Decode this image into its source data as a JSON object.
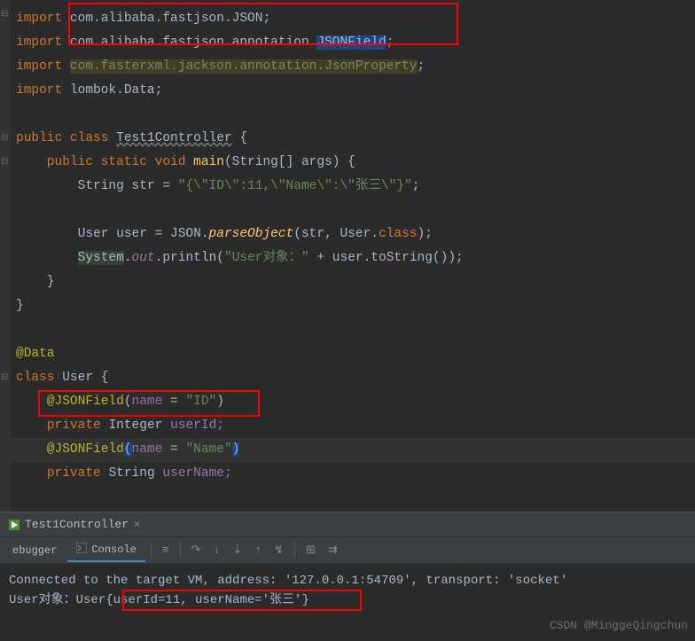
{
  "code": {
    "l1": {
      "kw": "import ",
      "rest": "com.alibaba.fastjson.JSON;"
    },
    "l2": {
      "kw": "import ",
      "rest": "com.alibaba.fastjson.annotation.",
      "hl": "JSONField",
      "end": ";"
    },
    "l3": {
      "kw": "import ",
      "unused": "com.fasterxml.jackson.annotation.JsonProperty",
      "end": ";"
    },
    "l4": {
      "kw": "import ",
      "rest": "lombok.Data;"
    },
    "l6": {
      "pre": "public class ",
      "name": "Test1Controller",
      "post": " {"
    },
    "l7": {
      "pre": "    public static void ",
      "m": "main",
      "post1": "(String[] args) {"
    },
    "l8": {
      "pre": "        String str = ",
      "str": "\"{\\\"ID\\\":11,\\\"Name\\\":\\\"张三\\\"}\"",
      "end": ";"
    },
    "l10": {
      "pre": "        User user = JSON.",
      "m": "parseObject",
      "post": "(str, User.",
      "kw2": "class",
      "end": ");"
    },
    "l11": {
      "pre1": "        ",
      "sys": "System",
      "dot1": ".",
      "out": "out",
      "dot2": ".println(",
      "str": "\"User对象：\"",
      "post": " + user.toString());"
    },
    "l12": "    }",
    "l13": "}",
    "l15": {
      "anno": "@Data"
    },
    "l16": {
      "kw": "class ",
      "name": "User {"
    },
    "l17": {
      "pre": "    ",
      "anno": "@JSONField",
      "paren": "(",
      "p": "name",
      "eq": " = ",
      "str": "\"ID\"",
      "close": ")"
    },
    "l18": {
      "pre": "    ",
      "kw": "private ",
      "type": "Integer ",
      "name": "userId;"
    },
    "l19": {
      "pre": "    ",
      "anno": "@JSONField",
      "paren": "(",
      "p": "name",
      "eq": " = ",
      "str": "\"Name\"",
      "close": ")"
    },
    "l20": {
      "pre": "    ",
      "kw": "private ",
      "type": "String ",
      "name": "userName;"
    }
  },
  "tab": {
    "name": "Test1Controller"
  },
  "toolbar": {
    "debugger": "ebugger",
    "console": "Console"
  },
  "console": {
    "line1": "Connected to the target VM, address: '127.0.0.1:54709', transport: 'socket'",
    "line2a": "User对象：User",
    "line2b": "{userId=11, userName='张三'}"
  },
  "watermark": "CSDN @MinggeQingchun"
}
